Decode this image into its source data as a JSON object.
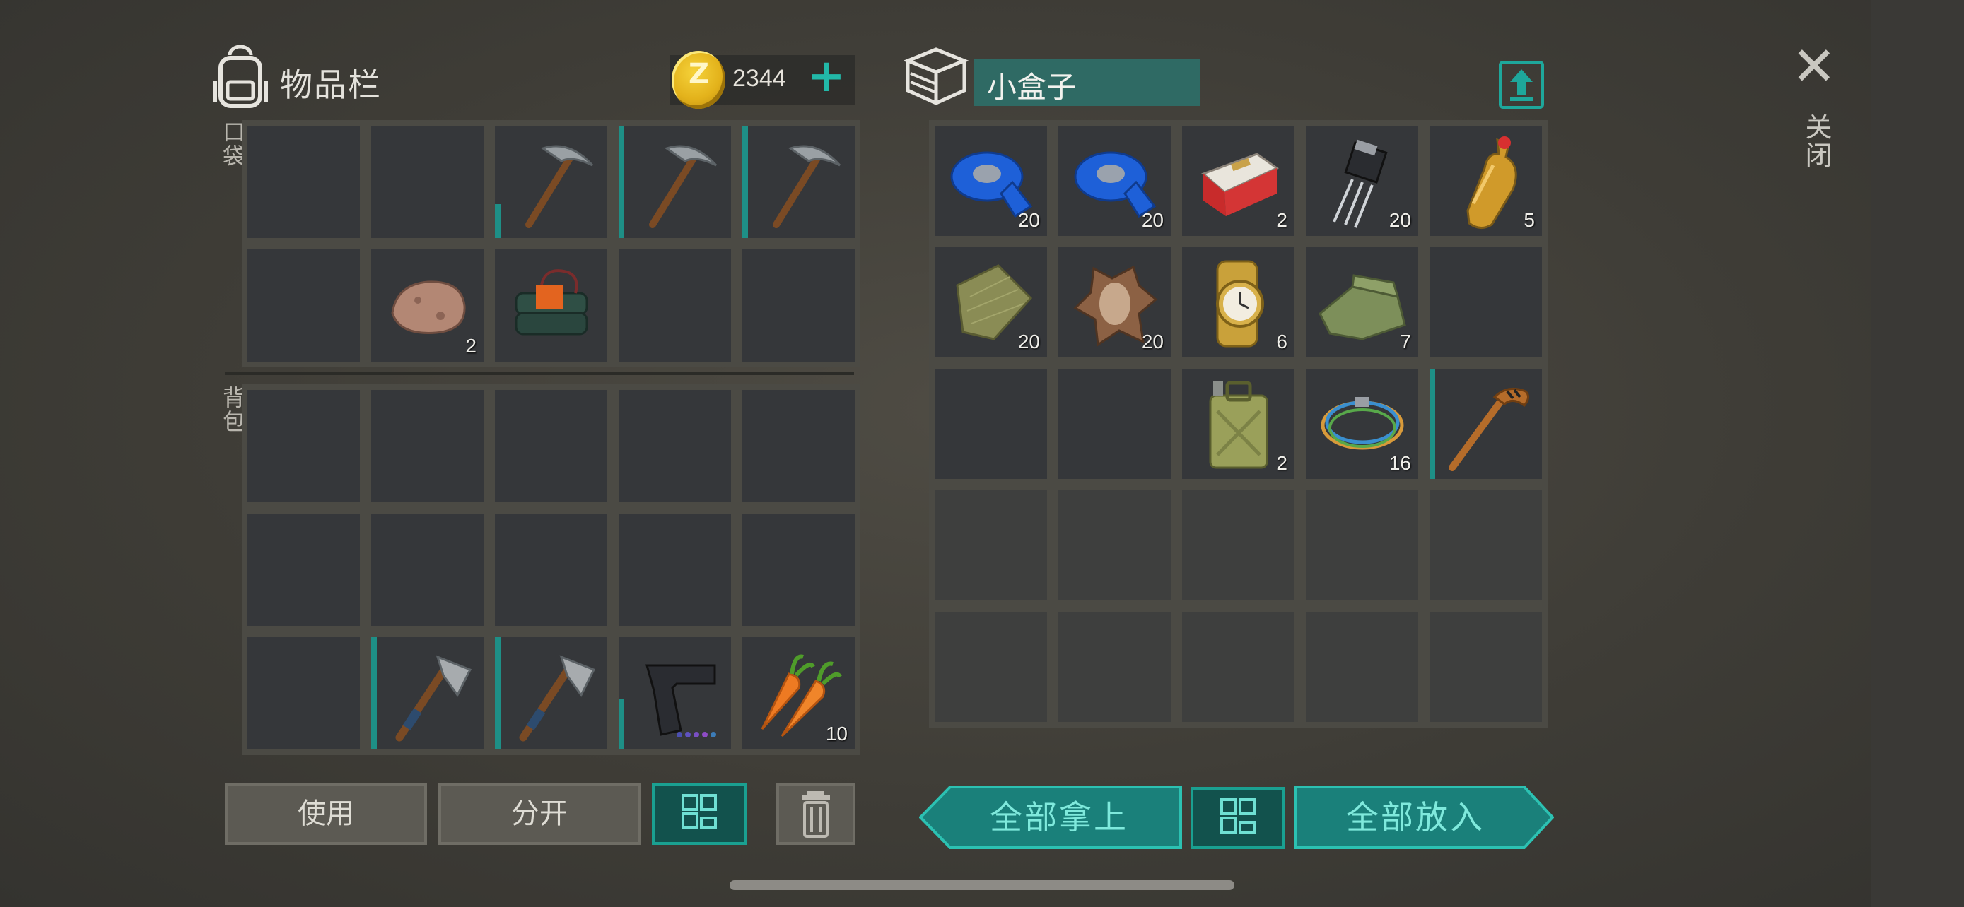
{
  "header": {
    "inventory_title": "物品栏",
    "coins": "2344",
    "coin_symbol": "Z",
    "add_symbol": "+",
    "box_name": "小盒子",
    "close_label": "关闭",
    "close_symbol": "✕"
  },
  "labels": {
    "pockets": "口袋",
    "backpack": "背包"
  },
  "pockets": [
    {
      "icon": "",
      "count": ""
    },
    {
      "icon": "",
      "count": ""
    },
    {
      "icon": "pickaxe-icon",
      "count": "",
      "durability": 0.3
    },
    {
      "icon": "pickaxe-icon",
      "count": "",
      "durability": 1.0
    },
    {
      "icon": "pickaxe-icon",
      "count": "",
      "durability": 1.0
    },
    {
      "icon": "",
      "count": ""
    },
    {
      "icon": "stone-icon",
      "count": "2"
    },
    {
      "icon": "c4-explosive-icon",
      "count": ""
    },
    {
      "icon": "",
      "count": ""
    },
    {
      "icon": "",
      "count": ""
    }
  ],
  "backpack": [
    {
      "icon": "",
      "count": ""
    },
    {
      "icon": "",
      "count": ""
    },
    {
      "icon": "",
      "count": ""
    },
    {
      "icon": "",
      "count": ""
    },
    {
      "icon": "",
      "count": ""
    },
    {
      "icon": "",
      "count": ""
    },
    {
      "icon": "",
      "count": ""
    },
    {
      "icon": "",
      "count": ""
    },
    {
      "icon": "",
      "count": ""
    },
    {
      "icon": "",
      "count": ""
    },
    {
      "icon": "",
      "count": ""
    },
    {
      "icon": "hatchet-icon",
      "count": "",
      "durability": 1.0
    },
    {
      "icon": "hatchet-icon",
      "count": "",
      "durability": 1.0
    },
    {
      "icon": "pistol-icon",
      "count": "",
      "durability": 0.45
    },
    {
      "icon": "carrot-icon",
      "count": "10"
    }
  ],
  "box": [
    {
      "icon": "blue-tape-icon",
      "count": "20"
    },
    {
      "icon": "blue-tape-icon",
      "count": "20"
    },
    {
      "icon": "cigarette-pack-icon",
      "count": "2"
    },
    {
      "icon": "transistor-icon",
      "count": "20"
    },
    {
      "icon": "soda-bottle-icon",
      "count": "5"
    },
    {
      "icon": "burlap-cloth-icon",
      "count": "20"
    },
    {
      "icon": "animal-hide-icon",
      "count": "20"
    },
    {
      "icon": "gold-watch-icon",
      "count": "6"
    },
    {
      "icon": "fabric-icon",
      "count": "7"
    },
    {
      "icon": "",
      "count": ""
    },
    {
      "icon": "",
      "count": ""
    },
    {
      "icon": "",
      "count": ""
    },
    {
      "icon": "jerry-can-icon",
      "count": "2"
    },
    {
      "icon": "cable-coil-icon",
      "count": "16"
    },
    {
      "icon": "hockey-stick-icon",
      "count": "",
      "durability": 1.0
    }
  ],
  "buttons": {
    "use": "使用",
    "split": "分开",
    "take_all": "全部拿上",
    "put_all": "全部放入"
  },
  "colors": {
    "accent": "#1ea79b",
    "accent_dark": "#12524d",
    "slot": "#35373a",
    "slot_border": "#4b4a44"
  }
}
